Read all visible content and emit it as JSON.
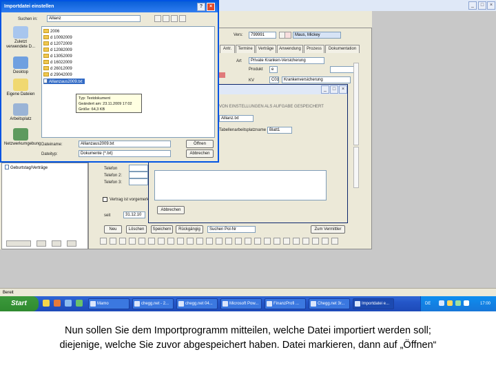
{
  "file_dialog": {
    "title": "Importdatei einstellen",
    "lookin_label": "Suchen in:",
    "lookin_value": "Allianz",
    "places": [
      {
        "label": "Zuletzt verwendete D..."
      },
      {
        "label": "Desktop"
      },
      {
        "label": "Eigene Dateien"
      },
      {
        "label": "Arbeitsplatz"
      },
      {
        "label": "Netzwerkumgebung"
      }
    ],
    "items": [
      {
        "name": "2006",
        "type": "folder"
      },
      {
        "name": "d 10092009",
        "type": "folder"
      },
      {
        "name": "d 12072009",
        "type": "folder"
      },
      {
        "name": "d 12082009",
        "type": "folder"
      },
      {
        "name": "d 13052009",
        "type": "folder"
      },
      {
        "name": "d 16022009",
        "type": "folder"
      },
      {
        "name": "d 26012009",
        "type": "folder"
      },
      {
        "name": "d 29042009",
        "type": "folder"
      },
      {
        "name": "Allianzaus2009.txt",
        "type": "file",
        "selected": true
      }
    ],
    "tooltip": {
      "line1": "Typ: Textdokument",
      "line2": "Geändert am: 23.11.2009 17:02",
      "line3": "Größe: 64,3 KB"
    },
    "filename_label": "Dateiname:",
    "filename_value": "Allianzaus2009.txt",
    "filetype_label": "Dateityp:",
    "filetype_value": "Dokumente (*.txt)",
    "open_button": "Öffnen",
    "cancel_button": "Abbrechen"
  },
  "form": {
    "vers_label": "Vers:",
    "vers_value": "799991",
    "name_value": "Maus, Mickey",
    "tabs": [
      "Antr.",
      "Termine",
      "Verträge",
      "Anwendung",
      "Prozess",
      "Dokumentation"
    ],
    "art_label": "Art",
    "art_value": "Private Kranken-Versicherung",
    "produkt_label": "Produkt",
    "produkt_value": "e",
    "kv_label": "KV",
    "kv_value": "C01",
    "kv_desc": "Krankenversicherung",
    "date_label": "seit",
    "date_value": "31.12.10",
    "telefon1_label": "Telefon",
    "telefon2_label": "Telefon 2:",
    "telefon3_label": "Telefon 3:",
    "checkbox_label": "Vertrag ist vorgemerkt",
    "bottom_buttons": [
      "Neu",
      "Löschen",
      "Speichern",
      "Rückgängig"
    ],
    "bottom_field": "Suchen Pol-Nr",
    "zum_vermittler": "Zum Vermittler",
    "left_item": "Geburtstag/Verträge"
  },
  "inner_dialog": {
    "heading": "VON EINSTELLUNGEN ALS AUFGABE GESPEICHERT",
    "field1": "Allianz.txt",
    "label2": "Tabellenarbeitsplatzname",
    "field2": "Blatt1",
    "abbrechen": "Abbrechen"
  },
  "status_bar": "Bereit",
  "taskbar": {
    "start": "Start",
    "tasks": [
      "Mamo",
      "chegg.net - 2...",
      "chegg.net 04...",
      "Microsoft Pow...",
      "FinanzProfi ...",
      "Chegg.net 3r...",
      "Importdatei e..."
    ],
    "tray_lang": "DE",
    "clock": "17:00"
  },
  "caption": {
    "line1": "Nun sollen Sie dem Importprogramm mitteilen, welche Datei importiert werden soll;",
    "line2": "diejenige, welche Sie zuvor abgespeichert haben. Datei markieren, dann auf „Öffnen“"
  },
  "colors": {
    "xp_blue": "#0054e3",
    "selection": "#316ac5",
    "window_bg": "#ece9d8",
    "tooltip_bg": "#ffffe1",
    "start_green": "#2f8a2f"
  }
}
